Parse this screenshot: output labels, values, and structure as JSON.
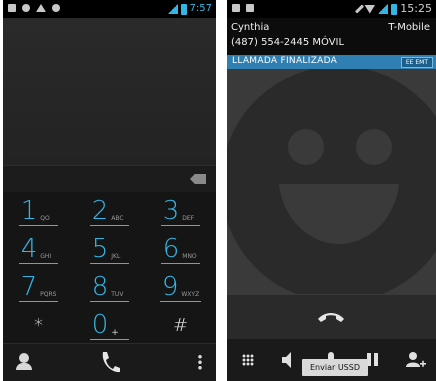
{
  "left_phone": {
    "status_bar": {
      "time": "7:57"
    },
    "keypad": [
      {
        "digit": "1",
        "letters": "QO"
      },
      {
        "digit": "2",
        "letters": "ABC"
      },
      {
        "digit": "3",
        "letters": "DEF"
      },
      {
        "digit": "4",
        "letters": "GHI"
      },
      {
        "digit": "5",
        "letters": "JKL"
      },
      {
        "digit": "6",
        "letters": "MNO"
      },
      {
        "digit": "7",
        "letters": "PQRS"
      },
      {
        "digit": "8",
        "letters": "TUV"
      },
      {
        "digit": "9",
        "letters": "WXYZ"
      },
      {
        "digit": "*",
        "letters": ""
      },
      {
        "digit": "0",
        "letters": "+"
      },
      {
        "digit": "#",
        "letters": ""
      }
    ]
  },
  "right_phone": {
    "status_bar": {
      "time": "15:25"
    },
    "caller_name": "Cynthia",
    "caller_number": "(487) 554-2445 MÓVIL",
    "carrier": "T-Mobile",
    "call_state": "LLAMADA FINALIZADA",
    "state_badge": "EE EMT",
    "tooltip": "Enviar USSD"
  },
  "colors": {
    "accent": "#33b5e5",
    "state_bar": "#2f7fb2"
  }
}
